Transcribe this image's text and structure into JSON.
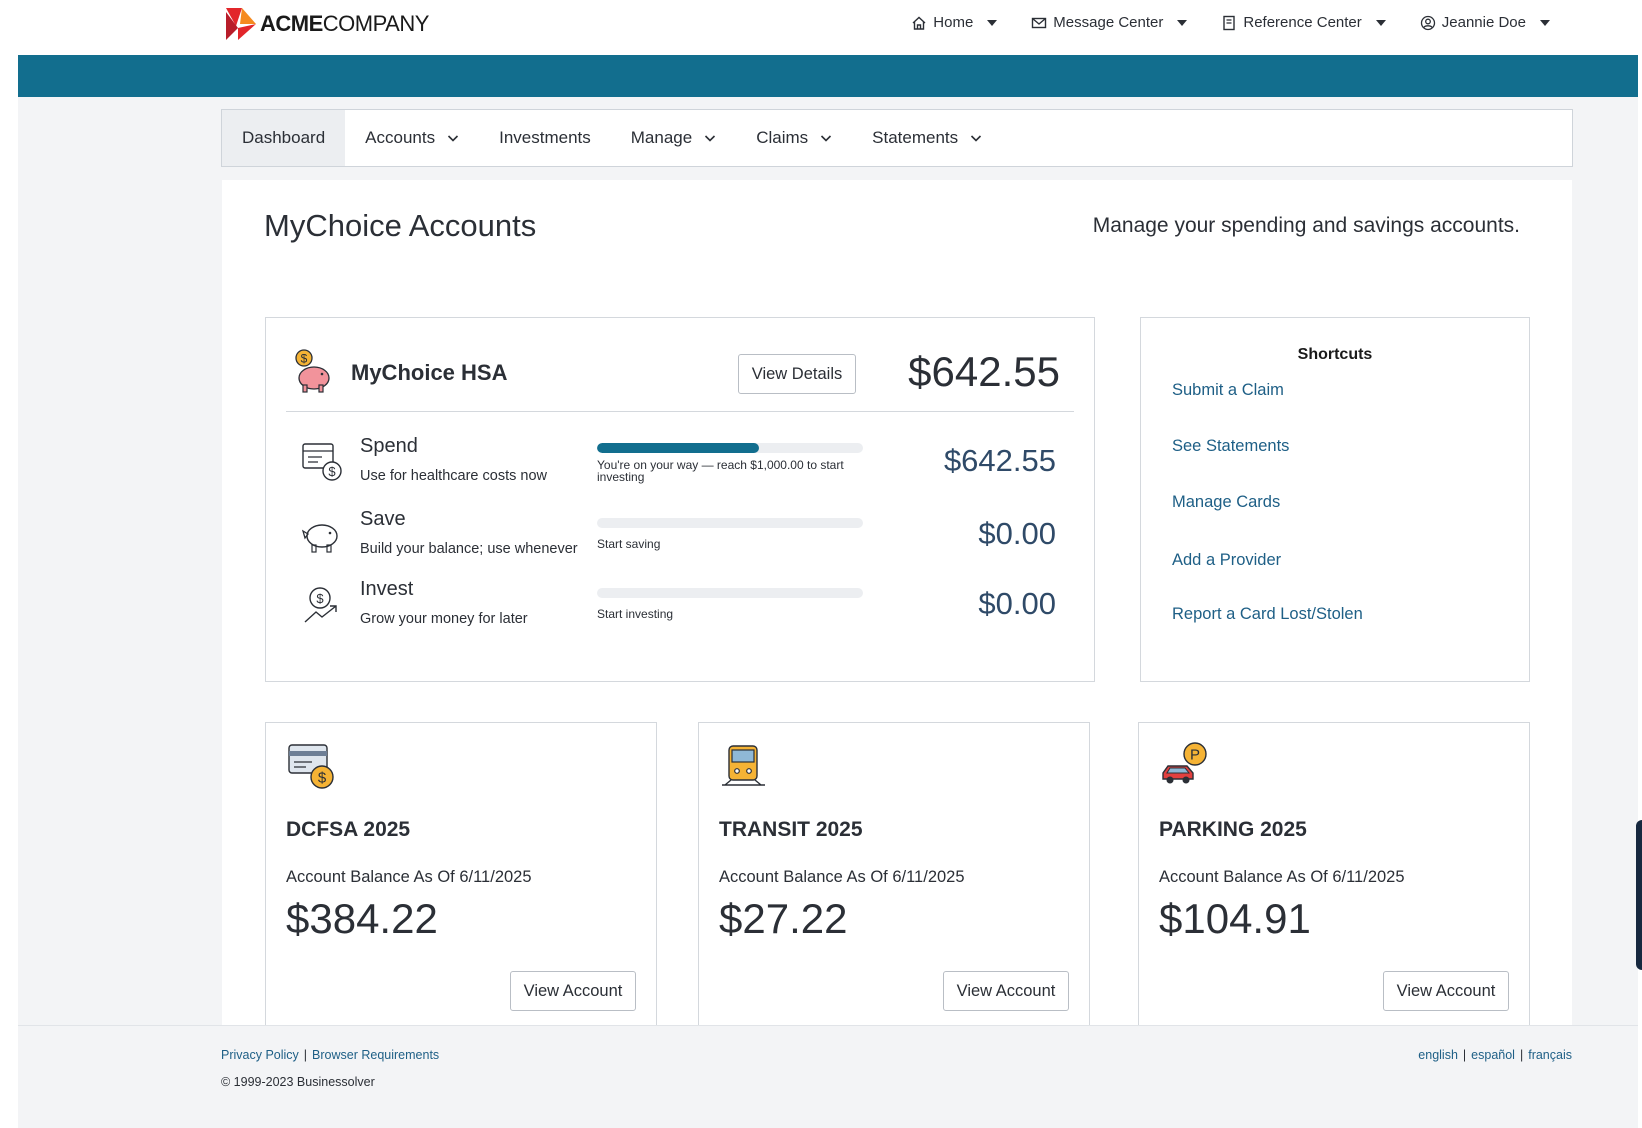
{
  "logo": {
    "bold": "ACME",
    "light": "COMPANY"
  },
  "top_nav": [
    {
      "label": "Home",
      "icon": "home-icon"
    },
    {
      "label": "Message Center",
      "icon": "mail-icon"
    },
    {
      "label": "Reference Center",
      "icon": "book-icon"
    },
    {
      "label": "Jeannie Doe",
      "icon": "user-icon"
    }
  ],
  "sub_nav": [
    {
      "label": "Dashboard",
      "active": true,
      "dropdown": false
    },
    {
      "label": "Accounts",
      "dropdown": true
    },
    {
      "label": "Investments",
      "dropdown": false
    },
    {
      "label": "Manage",
      "dropdown": true
    },
    {
      "label": "Claims",
      "dropdown": true
    },
    {
      "label": "Statements",
      "dropdown": true
    }
  ],
  "page": {
    "title": "MyChoice Accounts",
    "subtitle": "Manage your spending and savings accounts."
  },
  "hsa": {
    "name": "MyChoice HSA",
    "details_label": "View Details",
    "total": "$642.55",
    "rows": [
      {
        "title": "Spend",
        "desc": "Use for healthcare costs now",
        "note": "You're on your way — reach $1,000.00 to start investing",
        "amount": "$642.55",
        "progress": 0.61
      },
      {
        "title": "Save",
        "desc": "Build your balance; use whenever",
        "note": "Start saving",
        "amount": "$0.00",
        "progress": 0
      },
      {
        "title": "Invest",
        "desc": "Grow your money for later",
        "note": "Start investing",
        "amount": "$0.00",
        "progress": 0
      }
    ]
  },
  "shortcuts": {
    "title": "Shortcuts",
    "links": [
      "Submit a Claim",
      "See Statements",
      "Manage Cards",
      "Add a Provider",
      "Report a Card Lost/Stolen"
    ]
  },
  "accounts": [
    {
      "name": "DCFSA 2025",
      "balance_label": "Account Balance As Of 6/11/2025",
      "balance": "$384.22",
      "button": "View Account",
      "icon": "card-dollar-icon"
    },
    {
      "name": "TRANSIT 2025",
      "balance_label": "Account Balance As Of 6/11/2025",
      "balance": "$27.22",
      "button": "View Account",
      "icon": "train-icon"
    },
    {
      "name": "PARKING 2025",
      "balance_label": "Account Balance As Of 6/11/2025",
      "balance": "$104.91",
      "button": "View Account",
      "icon": "car-parking-icon"
    }
  ],
  "footer": {
    "privacy": "Privacy Policy",
    "browser": "Browser Requirements",
    "sep": "|",
    "copyright": "© 1999-2023 Businessolver",
    "languages": [
      "english",
      "español",
      "français"
    ]
  },
  "colors": {
    "brand_teal": "#126e8e",
    "link": "#1e5f86",
    "amount": "#2f4a68"
  }
}
